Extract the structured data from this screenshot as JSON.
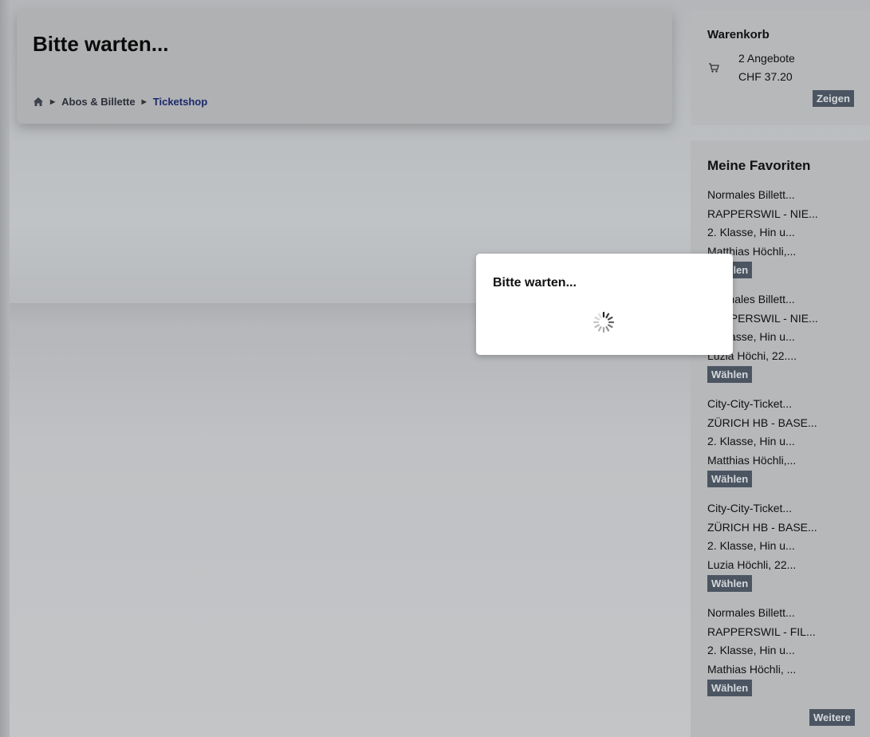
{
  "header": {
    "title": "Bitte warten...",
    "breadcrumb": {
      "home_icon": "home-icon",
      "items": [
        "Abos & Billette",
        "Ticketshop"
      ]
    }
  },
  "cart": {
    "title": "Warenkorb",
    "icon": "cart-icon",
    "count": "2 Angebote",
    "price": "CHF 37.20",
    "button": "Zeigen"
  },
  "favorites": {
    "title": "Meine Favoriten",
    "items": [
      {
        "lines": [
          "Normales Billett...",
          "RAPPERSWIL - NIE...",
          "2. Klasse, Hin u...",
          "Matthias Höchli,..."
        ],
        "button": "Wählen"
      },
      {
        "lines": [
          "Normales Billett...",
          "RAPPERSWIL - NIE...",
          "2. Klasse, Hin u...",
          "Luzia Höchi, 22...."
        ],
        "button": "Wählen"
      },
      {
        "lines": [
          "City-City-Ticket...",
          "ZÜRICH HB - BASE...",
          "2. Klasse, Hin u...",
          "Matthias Höchli,..."
        ],
        "button": "Wählen"
      },
      {
        "lines": [
          "City-City-Ticket...",
          "ZÜRICH HB - BASE...",
          "2. Klasse, Hin u...",
          "Luzia Höchli, 22..."
        ],
        "button": "Wählen"
      },
      {
        "lines": [
          "Normales Billett...",
          "RAPPERSWIL - FIL...",
          "2. Klasse, Hin u...",
          "Mathias Höchli, ..."
        ],
        "button": "Wählen"
      }
    ],
    "more_button": "Weitere"
  },
  "dialog": {
    "title": "Bitte warten...",
    "icon": "spinner-icon"
  },
  "colors": {
    "button_bg": "#4b5562",
    "breadcrumb_current": "#1b2a6b",
    "overlay": "#b7b9bc"
  }
}
